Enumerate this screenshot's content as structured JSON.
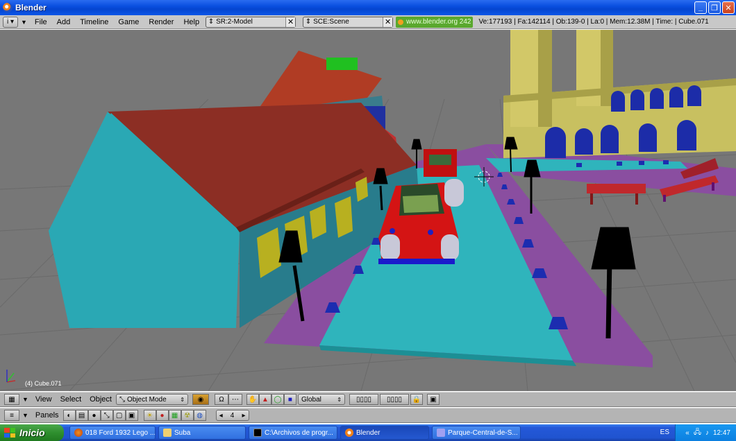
{
  "window": {
    "title": "Blender"
  },
  "info_header": {
    "menus": [
      "File",
      "Add",
      "Timeline",
      "Game",
      "Render",
      "Help"
    ],
    "screen_field": "SR:2-Model",
    "scene_field": "SCE:Scene",
    "url": "www.blender.org 242",
    "stats": "Ve:177193 | Fa:142114 | Ob:139-0 | La:0 | Mem:12.38M | Time: | Cube.071"
  },
  "viewport": {
    "object_label": "(4) Cube.071"
  },
  "view3d_header": {
    "menus": [
      "View",
      "Select",
      "Object"
    ],
    "mode": "Object Mode",
    "orientation": "Global"
  },
  "buttons_header": {
    "label": "Panels",
    "frame": "4"
  },
  "taskbar": {
    "start_label": "Inicio",
    "tasks": [
      {
        "label": "018 Ford 1932 Lego ..."
      },
      {
        "label": "Suba"
      },
      {
        "label": "C:\\Archivos de progr..."
      },
      {
        "label": "Blender"
      },
      {
        "label": "Parque-Central-de-S..."
      }
    ],
    "language": "ES",
    "clock": "12:47"
  }
}
